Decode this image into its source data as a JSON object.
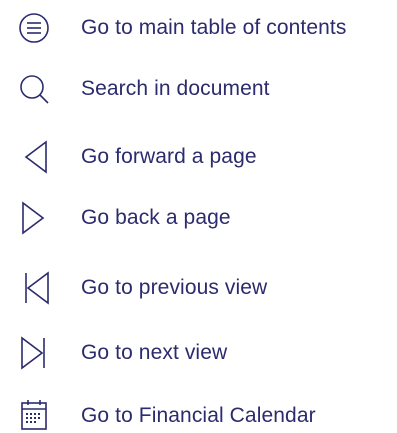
{
  "nav": {
    "items": [
      {
        "label": "Go to main table of contents",
        "icon": "menu-circle-icon"
      },
      {
        "label": "Search in document",
        "icon": "search-icon"
      },
      {
        "label": "Go forward a page",
        "icon": "triangle-left-icon"
      },
      {
        "label": "Go back a page",
        "icon": "triangle-right-icon"
      },
      {
        "label": "Go to previous view",
        "icon": "skip-previous-icon"
      },
      {
        "label": "Go to next view",
        "icon": "skip-next-icon"
      },
      {
        "label": "Go to Financial Calendar",
        "icon": "calendar-icon"
      }
    ]
  },
  "colors": {
    "accent": "#2b2b6e",
    "background": "#ffffff"
  }
}
